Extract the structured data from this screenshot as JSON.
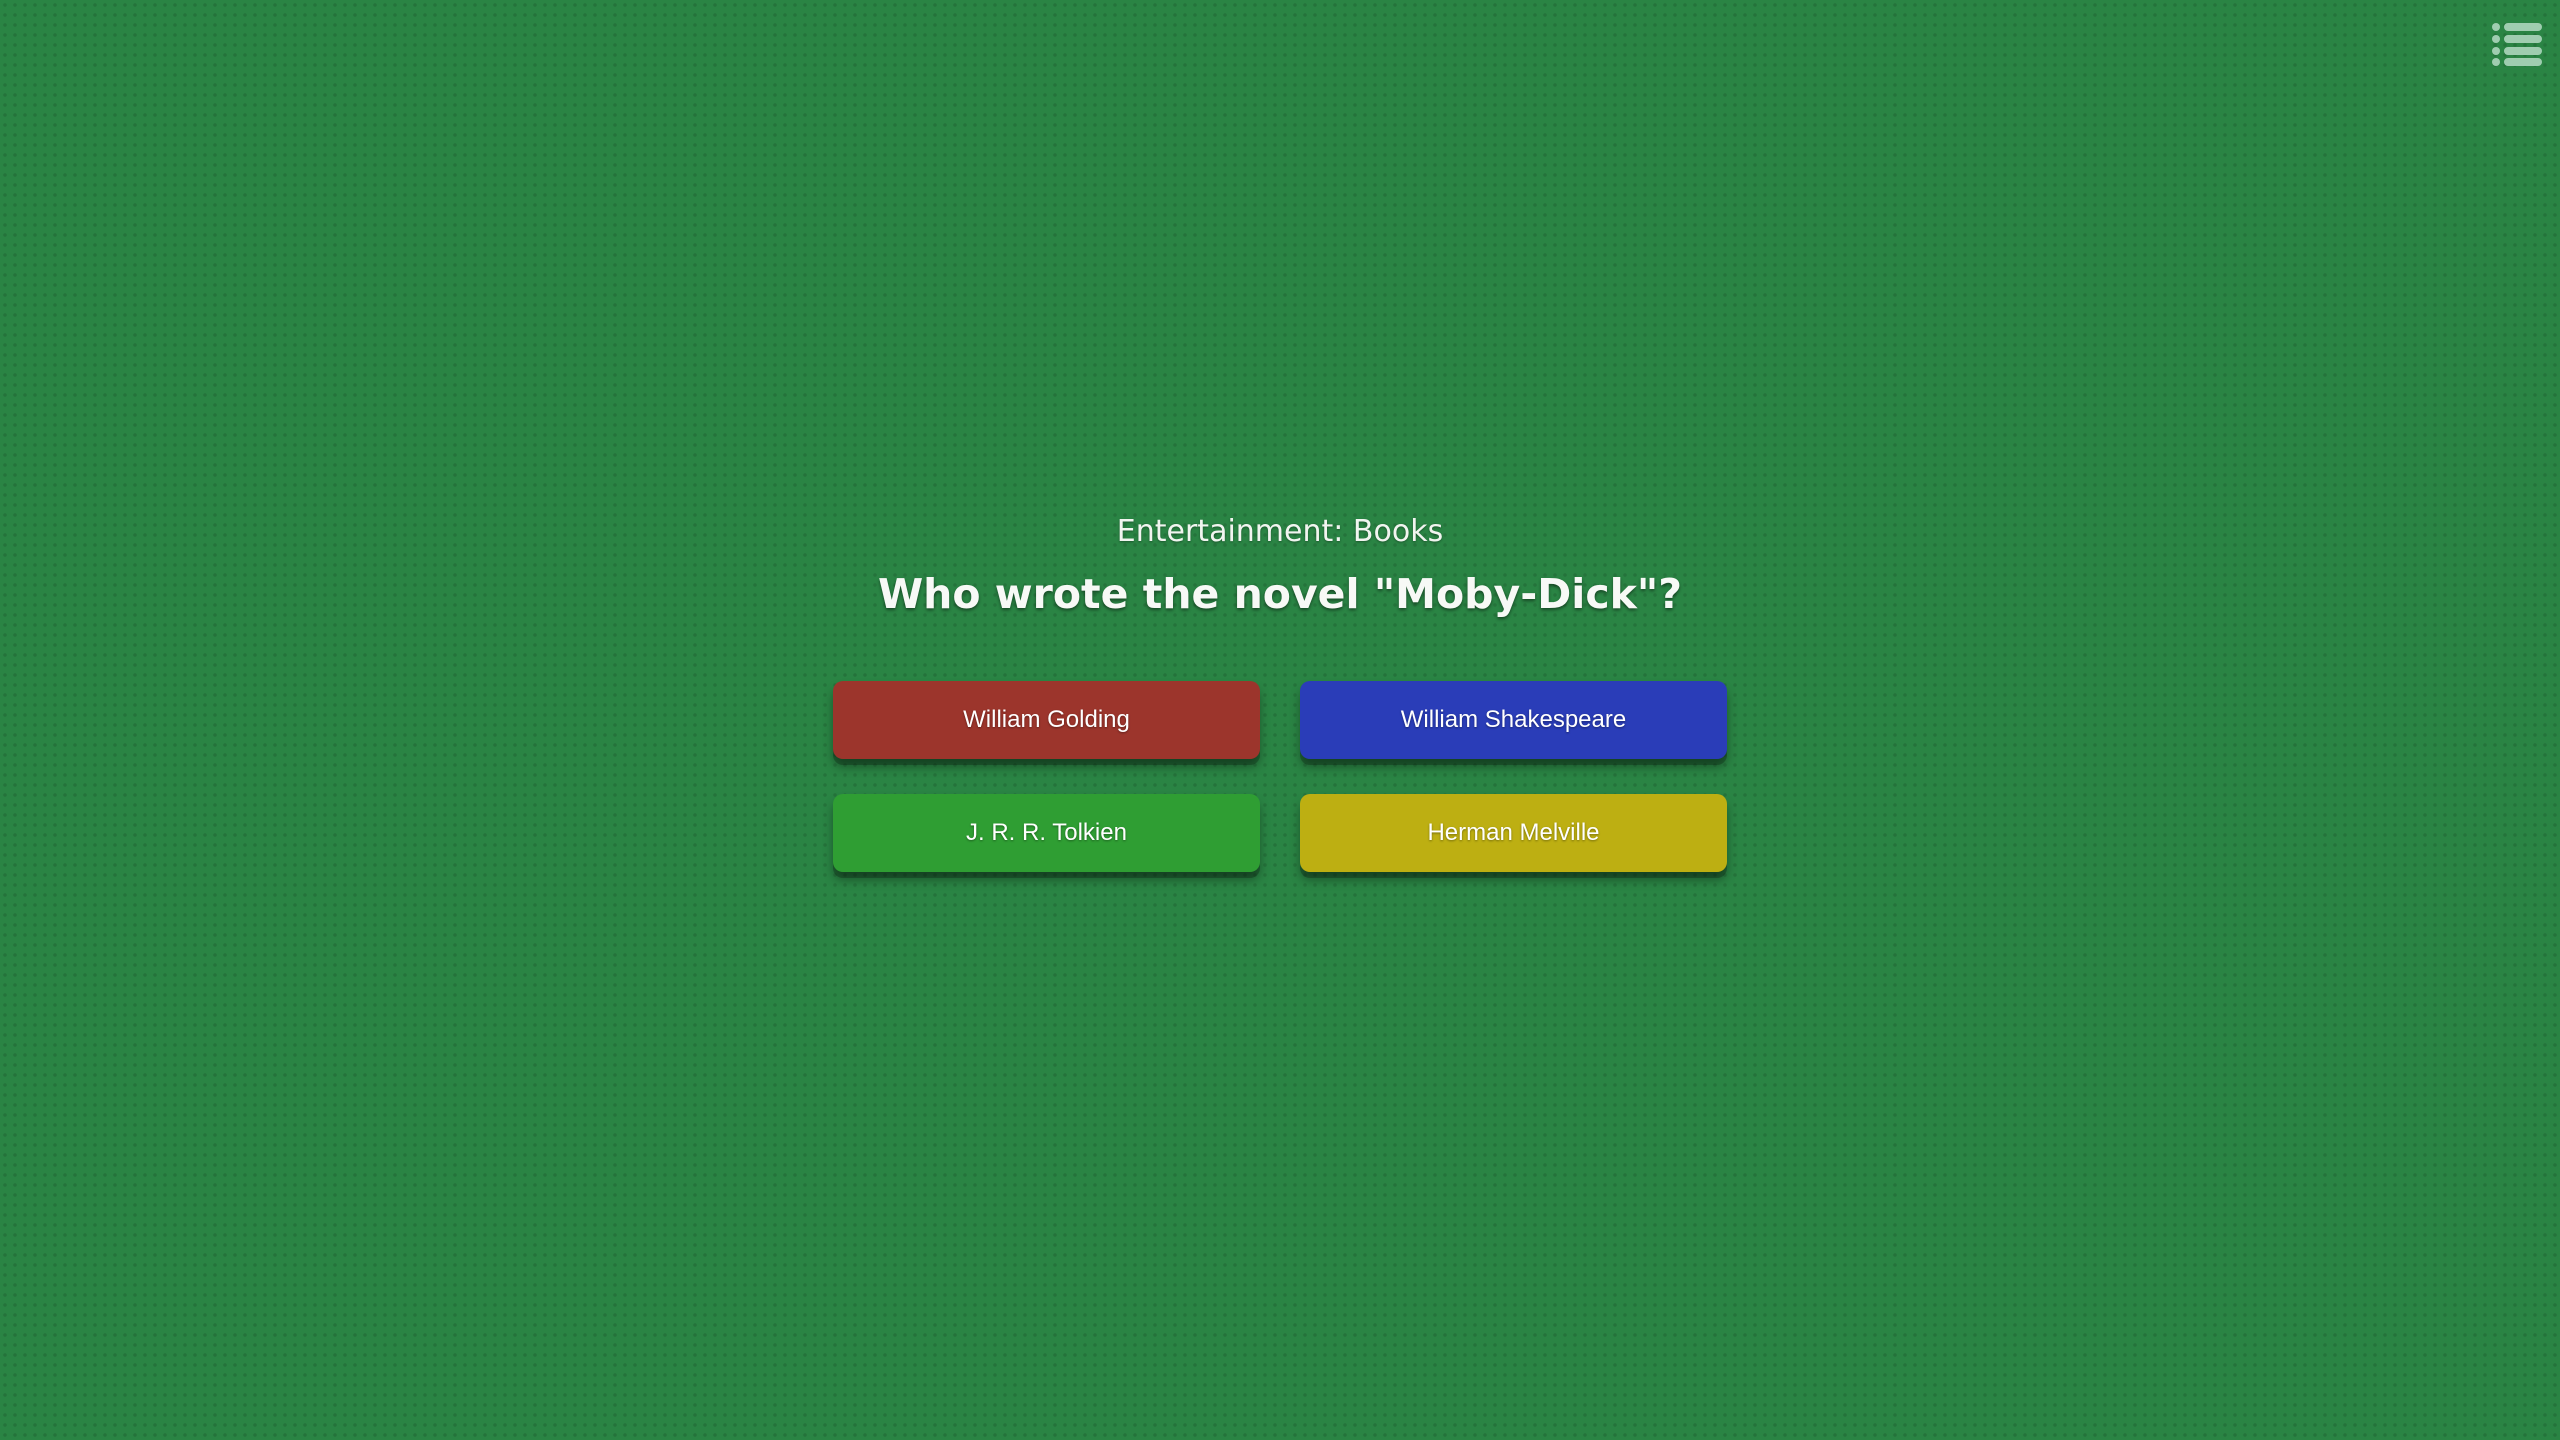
{
  "menu": {
    "icon": "list-icon",
    "color": "#9fcdb0"
  },
  "quiz": {
    "category": "Entertainment: Books",
    "question": "Who wrote the novel \"Moby-Dick\"?",
    "answers": [
      {
        "label": "William Golding",
        "color": "#9c352c"
      },
      {
        "label": "William Shakespeare",
        "color": "#2a3db8"
      },
      {
        "label": "J. R. R. Tolkien",
        "color": "#2f9e33"
      },
      {
        "label": "Herman Melville",
        "color": "#bdaf12"
      }
    ]
  }
}
